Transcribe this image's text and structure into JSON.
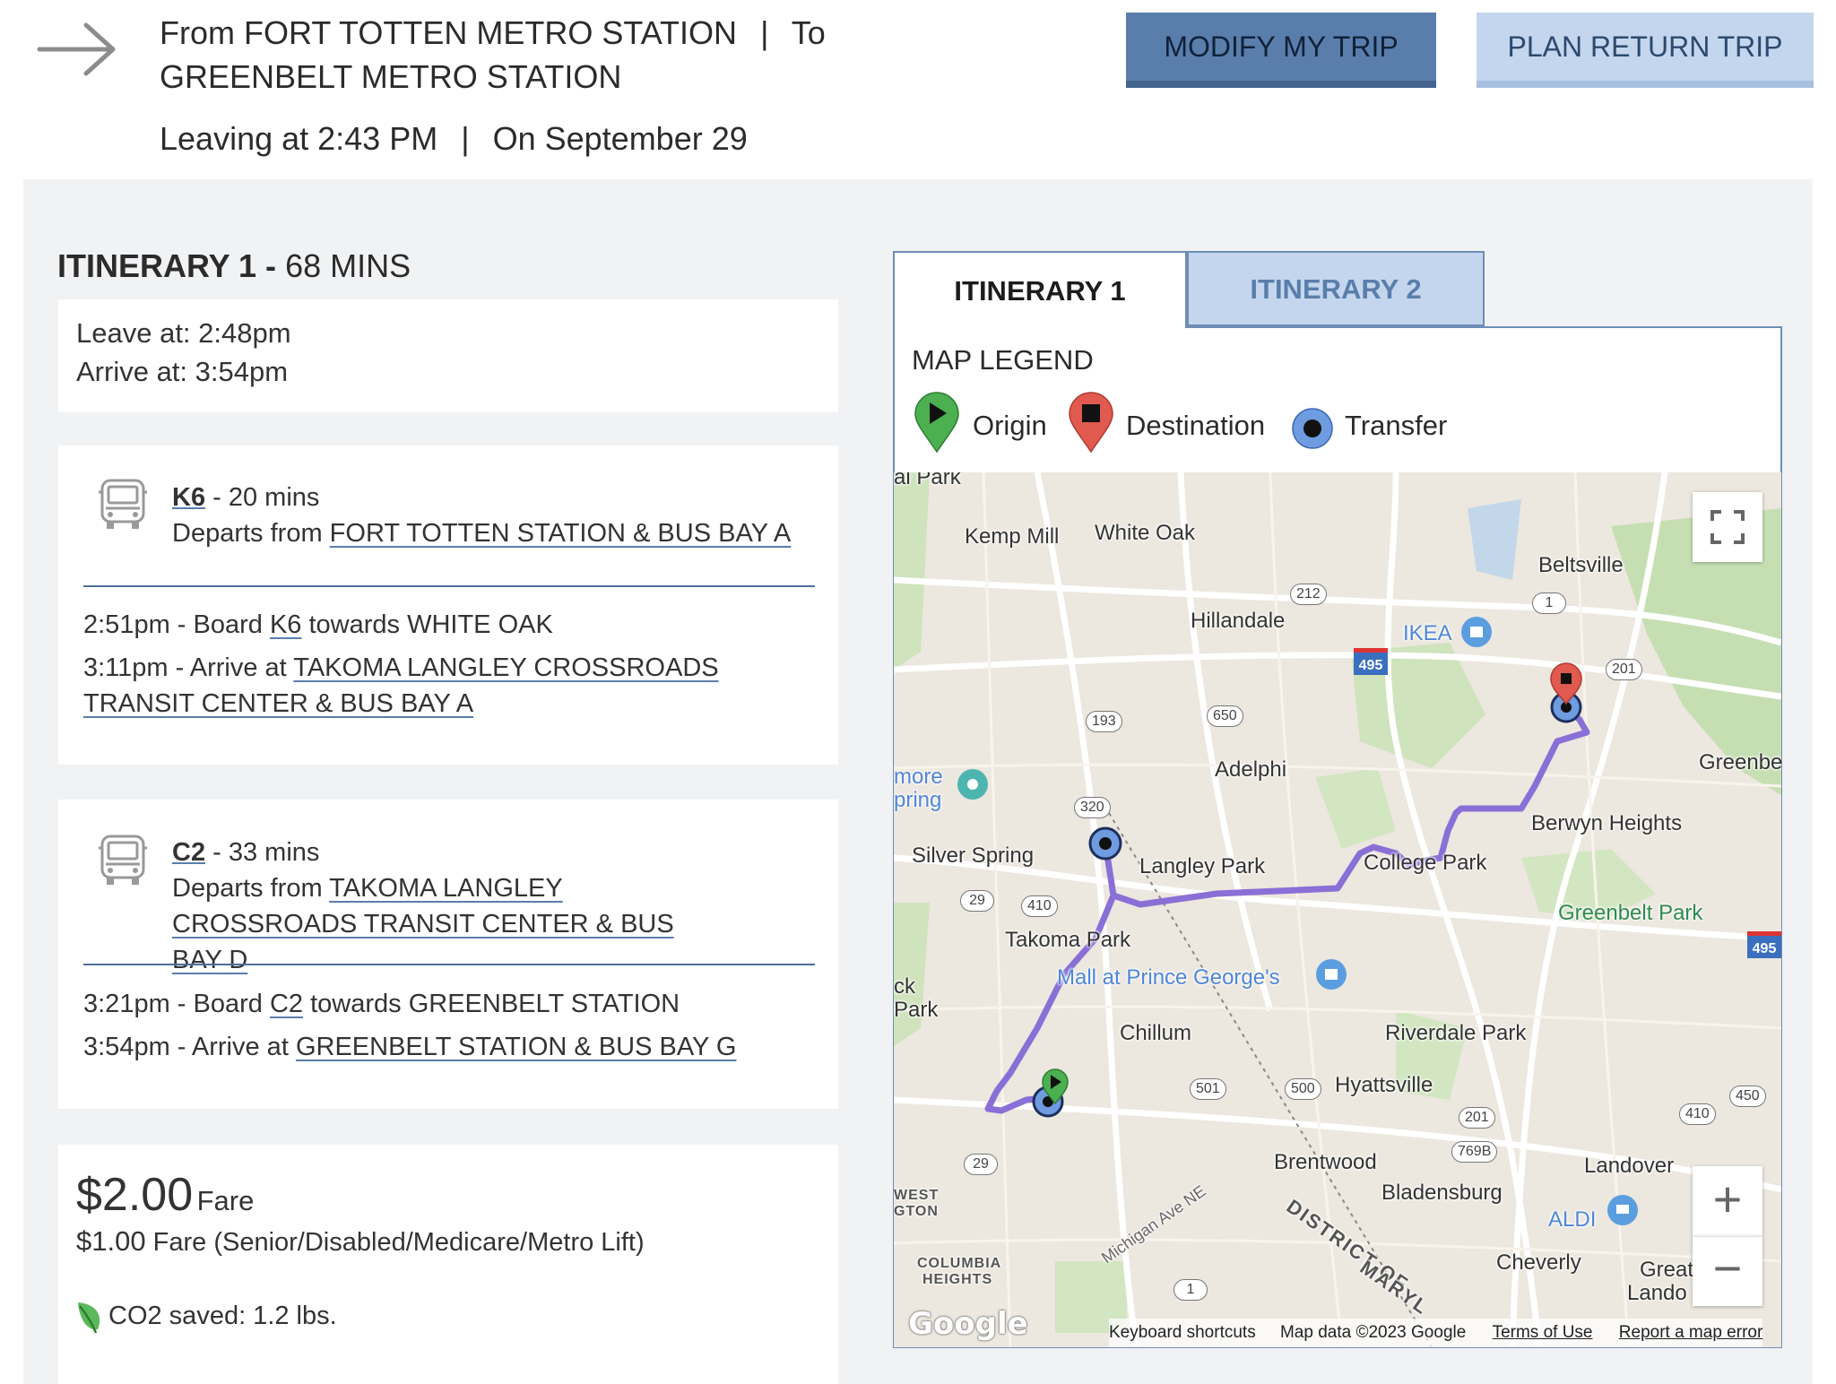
{
  "header": {
    "from_label": "From",
    "from_value": "FORT TOTTEN METRO STATION",
    "separator": "|",
    "to_label": "To",
    "to_value": "GREENBELT METRO STATION",
    "leaving": "Leaving at 2:43 PM",
    "date": "On September 29",
    "modify_button": "MODIFY MY TRIP",
    "return_button": "PLAN RETURN TRIP"
  },
  "itinerary": {
    "title_bold": "ITINERARY 1 -",
    "duration": "68 MINS",
    "leave": "Leave at: 2:48pm",
    "arrive": "Arrive at: 3:54pm",
    "legs": [
      {
        "route": "K6",
        "duration": "- 20 mins",
        "depart_prefix": "Departs from",
        "depart_stop": "FORT TOTTEN STATION & BUS BAY A",
        "board_time": "2:51pm - Board",
        "board_route": "K6",
        "board_towards": "towards WHITE OAK",
        "arrive_prefix": "3:11pm - Arrive at",
        "arrive_stop": "TAKOMA LANGLEY CROSSROADS TRANSIT CENTER & BUS BAY A"
      },
      {
        "route": "C2",
        "duration": "- 33 mins",
        "depart_prefix": "Departs from",
        "depart_stop": "TAKOMA LANGLEY CROSSROADS TRANSIT CENTER & BUS BAY D",
        "board_time": "3:21pm - Board",
        "board_route": "C2",
        "board_towards": "towards GREENBELT STATION",
        "arrive_prefix": "3:54pm - Arrive at",
        "arrive_stop": "GREENBELT STATION & BUS BAY G"
      }
    ],
    "fare": {
      "amount": "$2.00",
      "label": "Fare",
      "reduced_amount": "$1.00",
      "reduced_label": "Fare (Senior/Disabled/Medicare/Metro Lift)",
      "co2": "CO2 saved: 1.2 lbs."
    }
  },
  "map_panel": {
    "tabs": [
      {
        "label": "ITINERARY 1",
        "active": true
      },
      {
        "label": "ITINERARY 2",
        "active": false
      }
    ],
    "legend_title": "MAP LEGEND",
    "legend": {
      "origin": "Origin",
      "destination": "Destination",
      "transfer": "Transfer"
    },
    "colors": {
      "origin": "#4caf50",
      "destination": "#e05a4f",
      "transfer": "#6f9be0",
      "route": "#8a6fd6"
    },
    "places": {
      "kemp_mill": "Kemp Mill",
      "white_oak": "White Oak",
      "beltsville": "Beltsville",
      "hillandale": "Hillandale",
      "ikea": "IKEA",
      "adelphi": "Adelphi",
      "silver_spring_a": "more",
      "silver_spring_b": "pring",
      "silver_spring": "Silver Spring",
      "langley_park": "Langley Park",
      "college_park": "College Park",
      "berwyn_heights": "Berwyn Heights",
      "greenbelt": "Greenbe",
      "greenbelt_park": "Greenbelt Park",
      "takoma_park": "Takoma Park",
      "mall": "Mall at Prince George's",
      "chillum": "Chillum",
      "ck_park_a": "ck",
      "ck_park_b": "Park",
      "riverdale_park": "Riverdale Park",
      "hyattsville": "Hyattsville",
      "brentwood": "Brentwood",
      "bladensburg": "Bladensburg",
      "landover": "Landover",
      "aldi": "ALDI",
      "cheverly": "Cheverly",
      "great_landover_a": "Great",
      "great_landover_b": "Lando",
      "west_a": "WEST",
      "west_b": "GTON",
      "columbia_a": "COLUMBIA",
      "columbia_b": "HEIGHTS",
      "michigan": "Michigan Ave NE",
      "district": "DISTRICT OF",
      "maryland": "MARYL",
      "al_park": "al Park"
    },
    "shields": {
      "r212": "212",
      "r1a": "1",
      "r201": "201",
      "r495a": "495",
      "r193": "193",
      "r650": "650",
      "r320": "320",
      "r29a": "29",
      "r410a": "410",
      "r495b": "495",
      "r501": "501",
      "r500": "500",
      "r201b": "201",
      "r769": "769B",
      "r410b": "410",
      "r450": "450",
      "r29b": "29",
      "r1b": "1"
    },
    "zoom_in": "+",
    "zoom_out": "−",
    "google": "Google",
    "attribution": {
      "shortcuts": "Keyboard shortcuts",
      "data": "Map data ©2023 Google",
      "terms": "Terms of Use",
      "report": "Report a map error"
    }
  }
}
